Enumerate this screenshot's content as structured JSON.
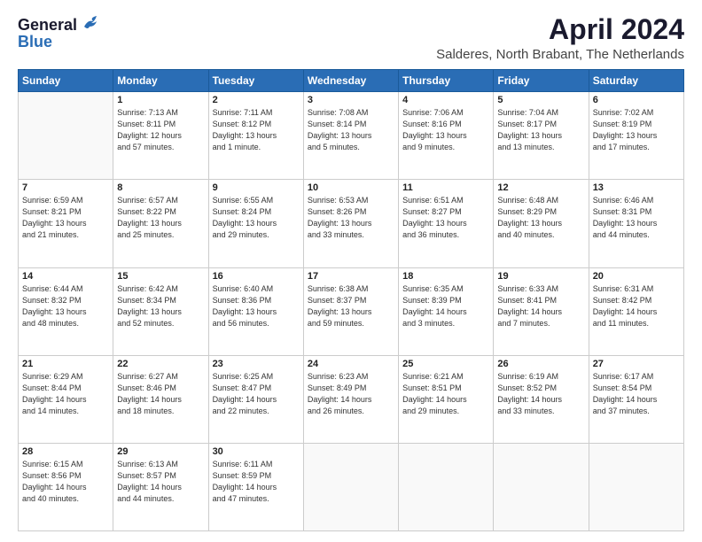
{
  "logo": {
    "general": "General",
    "blue": "Blue"
  },
  "header": {
    "month": "April 2024",
    "location": "Salderes, North Brabant, The Netherlands"
  },
  "weekdays": [
    "Sunday",
    "Monday",
    "Tuesday",
    "Wednesday",
    "Thursday",
    "Friday",
    "Saturday"
  ],
  "weeks": [
    [
      {
        "day": "",
        "empty": true
      },
      {
        "day": "1",
        "sunrise": "7:13 AM",
        "sunset": "8:11 PM",
        "daylight": "12 hours and 57 minutes."
      },
      {
        "day": "2",
        "sunrise": "7:11 AM",
        "sunset": "8:12 PM",
        "daylight": "13 hours and 1 minute."
      },
      {
        "day": "3",
        "sunrise": "7:08 AM",
        "sunset": "8:14 PM",
        "daylight": "13 hours and 5 minutes."
      },
      {
        "day": "4",
        "sunrise": "7:06 AM",
        "sunset": "8:16 PM",
        "daylight": "13 hours and 9 minutes."
      },
      {
        "day": "5",
        "sunrise": "7:04 AM",
        "sunset": "8:17 PM",
        "daylight": "13 hours and 13 minutes."
      },
      {
        "day": "6",
        "sunrise": "7:02 AM",
        "sunset": "8:19 PM",
        "daylight": "13 hours and 17 minutes."
      }
    ],
    [
      {
        "day": "7",
        "sunrise": "6:59 AM",
        "sunset": "8:21 PM",
        "daylight": "13 hours and 21 minutes."
      },
      {
        "day": "8",
        "sunrise": "6:57 AM",
        "sunset": "8:22 PM",
        "daylight": "13 hours and 25 minutes."
      },
      {
        "day": "9",
        "sunrise": "6:55 AM",
        "sunset": "8:24 PM",
        "daylight": "13 hours and 29 minutes."
      },
      {
        "day": "10",
        "sunrise": "6:53 AM",
        "sunset": "8:26 PM",
        "daylight": "13 hours and 33 minutes."
      },
      {
        "day": "11",
        "sunrise": "6:51 AM",
        "sunset": "8:27 PM",
        "daylight": "13 hours and 36 minutes."
      },
      {
        "day": "12",
        "sunrise": "6:48 AM",
        "sunset": "8:29 PM",
        "daylight": "13 hours and 40 minutes."
      },
      {
        "day": "13",
        "sunrise": "6:46 AM",
        "sunset": "8:31 PM",
        "daylight": "13 hours and 44 minutes."
      }
    ],
    [
      {
        "day": "14",
        "sunrise": "6:44 AM",
        "sunset": "8:32 PM",
        "daylight": "13 hours and 48 minutes."
      },
      {
        "day": "15",
        "sunrise": "6:42 AM",
        "sunset": "8:34 PM",
        "daylight": "13 hours and 52 minutes."
      },
      {
        "day": "16",
        "sunrise": "6:40 AM",
        "sunset": "8:36 PM",
        "daylight": "13 hours and 56 minutes."
      },
      {
        "day": "17",
        "sunrise": "6:38 AM",
        "sunset": "8:37 PM",
        "daylight": "13 hours and 59 minutes."
      },
      {
        "day": "18",
        "sunrise": "6:35 AM",
        "sunset": "8:39 PM",
        "daylight": "14 hours and 3 minutes."
      },
      {
        "day": "19",
        "sunrise": "6:33 AM",
        "sunset": "8:41 PM",
        "daylight": "14 hours and 7 minutes."
      },
      {
        "day": "20",
        "sunrise": "6:31 AM",
        "sunset": "8:42 PM",
        "daylight": "14 hours and 11 minutes."
      }
    ],
    [
      {
        "day": "21",
        "sunrise": "6:29 AM",
        "sunset": "8:44 PM",
        "daylight": "14 hours and 14 minutes."
      },
      {
        "day": "22",
        "sunrise": "6:27 AM",
        "sunset": "8:46 PM",
        "daylight": "14 hours and 18 minutes."
      },
      {
        "day": "23",
        "sunrise": "6:25 AM",
        "sunset": "8:47 PM",
        "daylight": "14 hours and 22 minutes."
      },
      {
        "day": "24",
        "sunrise": "6:23 AM",
        "sunset": "8:49 PM",
        "daylight": "14 hours and 26 minutes."
      },
      {
        "day": "25",
        "sunrise": "6:21 AM",
        "sunset": "8:51 PM",
        "daylight": "14 hours and 29 minutes."
      },
      {
        "day": "26",
        "sunrise": "6:19 AM",
        "sunset": "8:52 PM",
        "daylight": "14 hours and 33 minutes."
      },
      {
        "day": "27",
        "sunrise": "6:17 AM",
        "sunset": "8:54 PM",
        "daylight": "14 hours and 37 minutes."
      }
    ],
    [
      {
        "day": "28",
        "sunrise": "6:15 AM",
        "sunset": "8:56 PM",
        "daylight": "14 hours and 40 minutes."
      },
      {
        "day": "29",
        "sunrise": "6:13 AM",
        "sunset": "8:57 PM",
        "daylight": "14 hours and 44 minutes."
      },
      {
        "day": "30",
        "sunrise": "6:11 AM",
        "sunset": "8:59 PM",
        "daylight": "14 hours and 47 minutes."
      },
      {
        "day": "",
        "empty": true
      },
      {
        "day": "",
        "empty": true
      },
      {
        "day": "",
        "empty": true
      },
      {
        "day": "",
        "empty": true
      }
    ]
  ]
}
